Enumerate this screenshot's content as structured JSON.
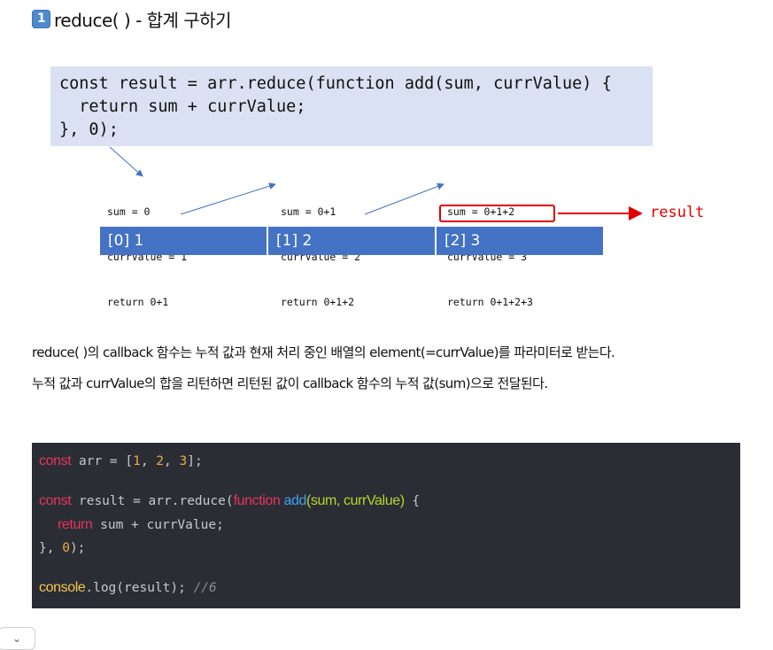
{
  "heading": {
    "badge": "1",
    "title": "reduce( ) - 합계 구하기"
  },
  "diagram": {
    "code_lines": [
      "const result = arr.reduce(function add(sum, currValue) {",
      "  return sum + currValue;",
      "}, 0);"
    ],
    "steps": [
      {
        "sum": "sum = 0",
        "curr": "currValue = 1",
        "ret": "return 0+1"
      },
      {
        "sum": "sum = 0+1",
        "curr": "currValue = 2",
        "ret": "return 0+1+2"
      },
      {
        "sum": "sum = 0+1+2",
        "curr": "currValue = 3",
        "ret": "return 0+1+2+3"
      }
    ],
    "result_label": "result",
    "array_cells": [
      "[0] 1",
      "[1] 2",
      "[2] 3"
    ],
    "colors": {
      "code_bg": "#d9e1f2",
      "array_bg": "#4472c4",
      "highlight": "#e00000"
    }
  },
  "paragraphs": [
    "reduce( )의 callback 함수는 누적 값과 현재 처리 중인 배열의 element(=currValue)를 파라미터로 받는다.",
    "누적 값과 currValue의 합을 리턴하면 리턴된 값이 callback 함수의 누적 값(sum)으로 전달된다."
  ],
  "code": {
    "line1": {
      "kw": "const",
      "rest": " arr = [",
      "n1": "1",
      "s1": ", ",
      "n2": "2",
      "s2": ", ",
      "n3": "3",
      "end": "];"
    },
    "line2": {
      "kw": "const",
      "mid": " result = arr.reduce(",
      "kw2": "function",
      "fn": " add",
      "params": "(sum, currValue)",
      "end": " {"
    },
    "line3": {
      "kw": "return",
      "rest": " sum + currValue;"
    },
    "line4": {
      "start": "}, ",
      "n": "0",
      "end": ");"
    },
    "line5": {
      "obj": "console",
      "rest": ".log(result); ",
      "comment": "//6"
    }
  },
  "collapse_icon": "chevron-down-icon"
}
